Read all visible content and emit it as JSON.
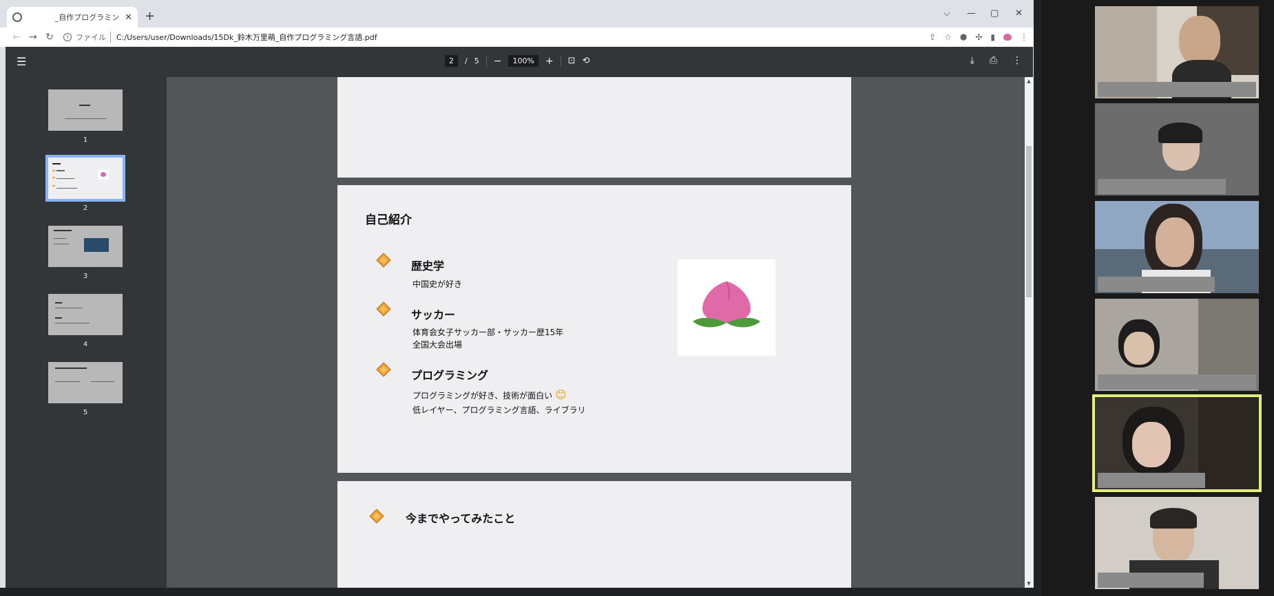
{
  "browser": {
    "tab_title": "_自作プログラミン",
    "tab_close": "✕",
    "new_tab": "+",
    "window_controls": {
      "dropdown": "⌵",
      "minimize": "—",
      "maximize": "▢",
      "close": "✕"
    },
    "url_scheme": "ファイル",
    "url_path": "C:/Users/user/Downloads/15Dk_鈴木万里萌_自作プログラミング言語.pdf"
  },
  "pdf": {
    "page_current": "2",
    "page_sep": "/",
    "page_total": "5",
    "zoom": "100%",
    "zoom_out": "−",
    "zoom_in": "+",
    "thumbnails": [
      {
        "num": "1"
      },
      {
        "num": "2"
      },
      {
        "num": "3"
      },
      {
        "num": "4"
      },
      {
        "num": "5"
      }
    ],
    "slide2": {
      "title": "自己紹介",
      "items": [
        {
          "heading": "歴史学",
          "lines": [
            "中国史が好き"
          ]
        },
        {
          "heading": "サッカー",
          "lines": [
            "体育会女子サッカー部・サッカー歴15年",
            "全国大会出場"
          ]
        },
        {
          "heading": "プログラミング",
          "lines": [
            "プログラミングが好き、技術が面白い",
            "低レイヤー、プログラミング言語、ライブラリ"
          ],
          "emoji": "😊"
        }
      ]
    },
    "slide3": {
      "heading": "今までやってみたこと"
    }
  },
  "colors": {
    "pdf_toolbar": "#323639",
    "pdf_bg": "#525659",
    "bullet_orange": "#f0a43a",
    "peach_pink": "#e06aa8",
    "leaf_green": "#4c9a3c",
    "active_speaker": "#e4f07a"
  },
  "icons": [
    "back-icon",
    "forward-icon",
    "reload-icon",
    "menu-icon",
    "fit-page-icon",
    "rotate-icon",
    "download-icon",
    "print-icon",
    "more-icon"
  ]
}
